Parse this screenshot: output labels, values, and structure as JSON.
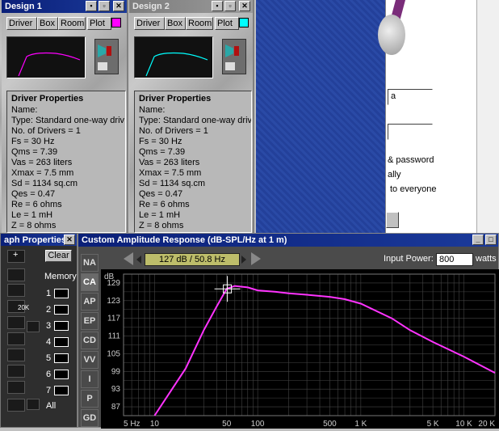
{
  "design1": {
    "title": "Design 1",
    "buttons": {
      "driver": "Driver",
      "box": "Box",
      "room": "Room",
      "plot": "Plot"
    },
    "plot_color": "#ff00ff",
    "props": {
      "heading": "Driver Properties",
      "lines": [
        "Name:",
        "Type: Standard one-way driv",
        "No. of Drivers = 1",
        "Fs =  30 Hz",
        "Qms =  7.39",
        "Vas =  263 liters",
        "Xmax =  7.5 mm",
        "Sd =  1134 sq.cm",
        "Qes =  0.47",
        "Re =  6 ohms",
        "Le =  1 mH",
        "Z =  8 ohms"
      ]
    }
  },
  "design2": {
    "title": "Design 2",
    "buttons": {
      "driver": "Driver",
      "box": "Box",
      "room": "Room",
      "plot": "Plot"
    },
    "plot_color": "#00ffff",
    "props": {
      "heading": "Driver Properties",
      "lines": [
        "Name:",
        "Type: Standard one-way driv",
        "No. of Drivers = 1",
        "Fs =  30 Hz",
        "Qms =  7.39",
        "Vas =  263 liters",
        "Xmax =  7.5 mm",
        "Sd =  1134 sq.cm",
        "Qes =  0.47",
        "Re =  6 ohms",
        "Le =  1 mH",
        "Z =  8 ohms"
      ]
    }
  },
  "bgwindow": {
    "field1": "a",
    "text1": "& password",
    "text2": "ally",
    "text3": "to everyone"
  },
  "graph_props": {
    "title": "aph Properties",
    "clear_label": "Clear",
    "memory_label": "Memory",
    "memory_slots": [
      "1",
      "2",
      "3",
      "4",
      "5",
      "6",
      "7"
    ],
    "all_label": "All",
    "icon_20k": "20K"
  },
  "response": {
    "title": "Custom Amplitude Response (dB-SPL/Hz at 1 m)",
    "readout": "127 dB / 50.8 Hz",
    "input_power_label": "Input Power:",
    "input_power_value": "800",
    "input_power_unit": "watts",
    "db_unit": "dB",
    "side_tabs": [
      "NA",
      "CA",
      "AP",
      "EP",
      "CD",
      "VV",
      "I",
      "P",
      "GD"
    ]
  },
  "chart_data": {
    "type": "line",
    "title": "Custom Amplitude Response (dB-SPL/Hz at 1 m)",
    "xscale": "log",
    "xlim": [
      5,
      20000
    ],
    "ylim": [
      84,
      132
    ],
    "yticks": [
      129,
      123,
      117,
      111,
      105,
      99,
      93,
      87
    ],
    "xticks": [
      {
        "v": 5,
        "l": "5 Hz"
      },
      {
        "v": 10,
        "l": "10"
      },
      {
        "v": 50,
        "l": "50"
      },
      {
        "v": 100,
        "l": "100"
      },
      {
        "v": 500,
        "l": "500"
      },
      {
        "v": 1000,
        "l": "1 K"
      },
      {
        "v": 5000,
        "l": "5 K"
      },
      {
        "v": 10000,
        "l": "10 K"
      },
      {
        "v": 20000,
        "l": "20 K"
      }
    ],
    "grid": true,
    "series": [
      {
        "color": "#ff33ff",
        "x": [
          10,
          20,
          30,
          40,
          50,
          60,
          80,
          100,
          150,
          200,
          300,
          500,
          700,
          1000,
          2000,
          3000,
          5000,
          10000,
          20000
        ],
        "y": [
          84,
          100,
          113,
          121,
          127,
          128,
          127.5,
          126.5,
          126,
          125.5,
          125,
          124.3,
          123.5,
          122,
          117,
          113,
          109,
          104,
          98.5
        ]
      }
    ],
    "cursor": {
      "x": 50.8,
      "y": 127
    }
  }
}
